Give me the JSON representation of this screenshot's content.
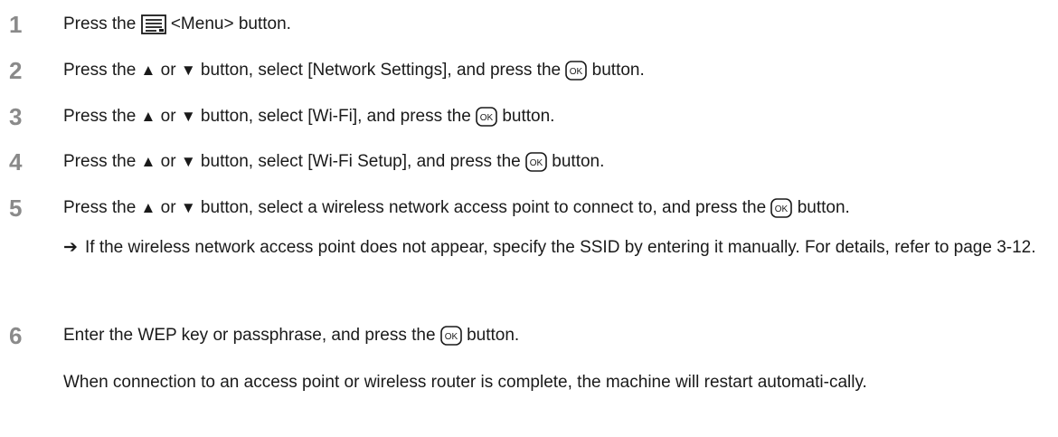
{
  "steps": [
    {
      "number": "1",
      "before": "Press the ",
      "after": " <Menu> button."
    },
    {
      "number": "2",
      "part1": "Press the ",
      "up": "▲",
      "or": " or ",
      "down": "▼",
      "part2": " button, select [Network Settings], and press the ",
      "part3": " button."
    },
    {
      "number": "3",
      "part1": "Press the ",
      "up": "▲",
      "or": " or ",
      "down": "▼",
      "part2": " button, select [Wi-Fi], and press the ",
      "part3": " button."
    },
    {
      "number": "4",
      "part1": "Press the ",
      "up": "▲",
      "or": " or ",
      "down": "▼",
      "part2": " button, select [Wi-Fi Setup], and press the ",
      "part3": " button."
    },
    {
      "number": "5",
      "part1": "Press the ",
      "up": "▲",
      "or": " or ",
      "down": "▼",
      "part2": " button, select a wireless network access point to connect to, and press the ",
      "part3": " button.",
      "sub_arrow": "➔",
      "sub_text": "If the wireless network access point does not appear, specify the SSID by entering it manually. For details, refer to page 3-12."
    },
    {
      "number": "6",
      "part1": "Enter the WEP key or passphrase, and press the ",
      "part3": " button.",
      "note": "When connection to an access point or wireless router is complete, the machine will restart automati-cally."
    }
  ],
  "icons": {
    "menu": "menu-button-icon",
    "ok": "ok-button-icon"
  }
}
